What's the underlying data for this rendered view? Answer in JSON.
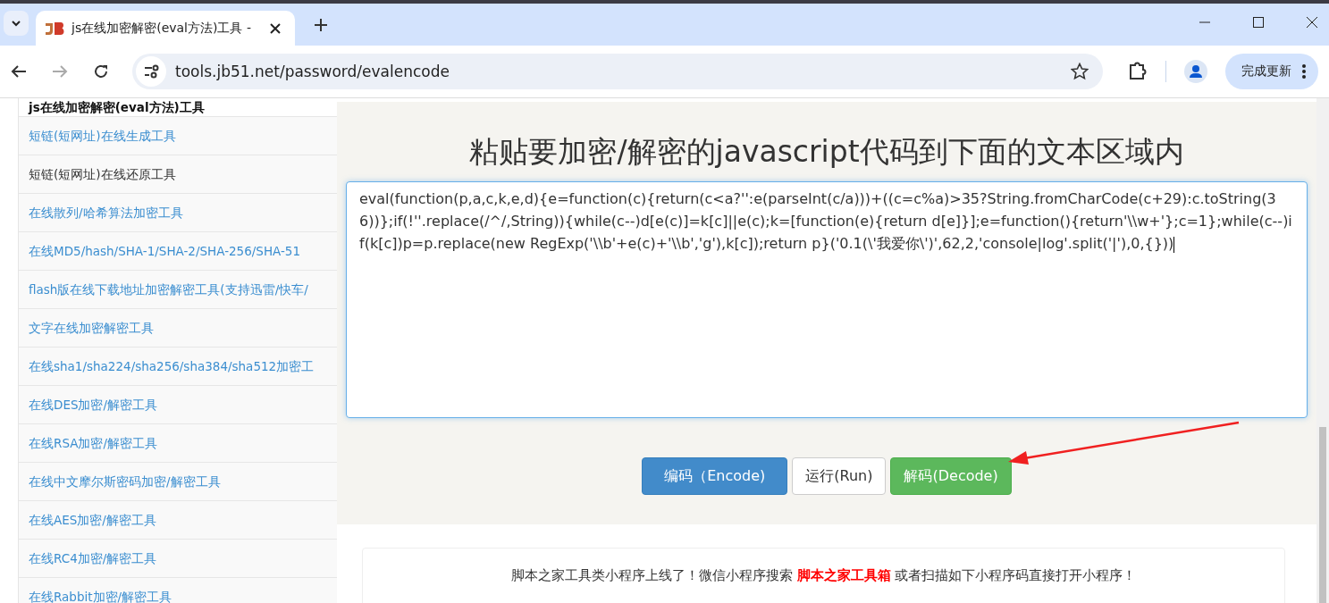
{
  "browser": {
    "tab_title": "js在线加密解密(eval方法)工具 -",
    "url": "tools.jb51.net/password/evalencode",
    "update_button": "完成更新"
  },
  "sidebar": {
    "items": [
      {
        "label": "js在线加密解密(eval方法)工具",
        "kind": "current"
      },
      {
        "label": "短链(短网址)在线生成工具",
        "kind": "link"
      },
      {
        "label": "短链(短网址)在线还原工具",
        "kind": "hovered"
      },
      {
        "label": "在线散列/哈希算法加密工具",
        "kind": "link"
      },
      {
        "label": "在线MD5/hash/SHA-1/SHA-2/SHA-256/SHA-51",
        "kind": "link"
      },
      {
        "label": "flash版在线下载地址加密解密工具(支持迅雷/快车/",
        "kind": "link"
      },
      {
        "label": "文字在线加密解密工具",
        "kind": "link"
      },
      {
        "label": "在线sha1/sha224/sha256/sha384/sha512加密工",
        "kind": "link"
      },
      {
        "label": "在线DES加密/解密工具",
        "kind": "link"
      },
      {
        "label": "在线RSA加密/解密工具",
        "kind": "link"
      },
      {
        "label": "在线中文摩尔斯密码加密/解密工具",
        "kind": "link"
      },
      {
        "label": "在线AES加密/解密工具",
        "kind": "link"
      },
      {
        "label": "在线RC4加密/解密工具",
        "kind": "link"
      },
      {
        "label": "在线Rabbit加密/解密工具",
        "kind": "link"
      }
    ]
  },
  "main": {
    "title": "粘贴要加密/解密的javascript代码到下面的文本区域内",
    "code": "eval(function(p,a,c,k,e,d){e=function(c){return(c<a?'':e(parseInt(c/a)))+((c=c%a)>35?String.fromCharCode(c+29):c.toString(36))};if(!''.replace(/^/,String)){while(c--)d[e(c)]=k[c]||e(c);k=[function(e){return d[e]}];e=function(){return'\\\\w+'};c=1};while(c--)if(k[c])p=p.replace(new RegExp('\\\\b'+e(c)+'\\\\b','g'),k[c]);return p}('0.1(\\'我爱你\\')',62,2,'console|log'.split('|'),0,{}))",
    "buttons": [
      {
        "label": "编码（Encode)",
        "kind": "primary"
      },
      {
        "label": "运行(Run)",
        "kind": "default"
      },
      {
        "label": "解码(Decode)",
        "kind": "success"
      }
    ],
    "notice": "脚本之家工具类小程序上线了！微信小程序搜索 **脚本之家工具箱** 或者扫描如下小程序码直接打开小程序！"
  }
}
